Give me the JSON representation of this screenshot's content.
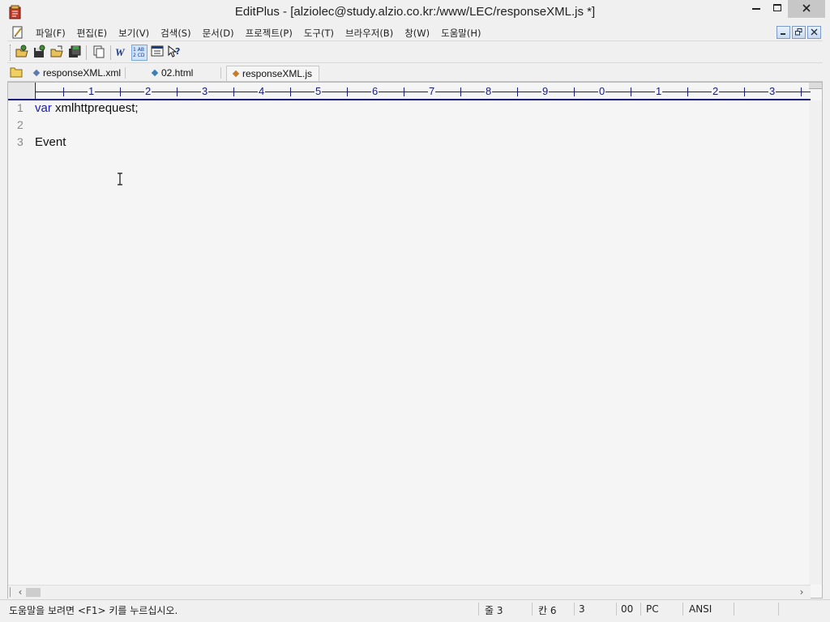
{
  "window": {
    "title": "EditPlus - [alziolec@study.alzio.co.kr:/www/LEC/responseXML.js *]"
  },
  "menu": {
    "items": [
      "파일(F)",
      "편집(E)",
      "보기(V)",
      "검색(S)",
      "문서(D)",
      "프로젝트(P)",
      "도구(T)",
      "브라우저(B)",
      "창(W)",
      "도움말(H)"
    ]
  },
  "tabs": [
    {
      "label": "responseXML.xml",
      "dot_color": "#5b7bb0"
    },
    {
      "label": "02.html",
      "dot_color": "#3a7fb5"
    },
    {
      "label": "responseXML.js",
      "dot_color": "#c77a2a"
    }
  ],
  "ruler": {
    "numbers": [
      "1",
      "2",
      "3",
      "4",
      "5",
      "6",
      "7",
      "8",
      "9",
      "0",
      "1",
      "2",
      "3"
    ]
  },
  "editor": {
    "lines": [
      {
        "num": "1",
        "keyword": "var",
        "rest": " xmlhttprequest;"
      },
      {
        "num": "2",
        "keyword": "",
        "rest": ""
      },
      {
        "num": "3",
        "keyword": "",
        "rest": "Event"
      }
    ]
  },
  "status": {
    "help": "도움말을 보려면 <F1> 키를 누르십시오.",
    "line": "줄 3",
    "col": "칸 6",
    "sel": "3",
    "code": "00",
    "mode": "PC",
    "encoding": "ANSI"
  },
  "colors": {
    "ruler": "#1a1a7a",
    "keyword": "#1a1ab4"
  }
}
